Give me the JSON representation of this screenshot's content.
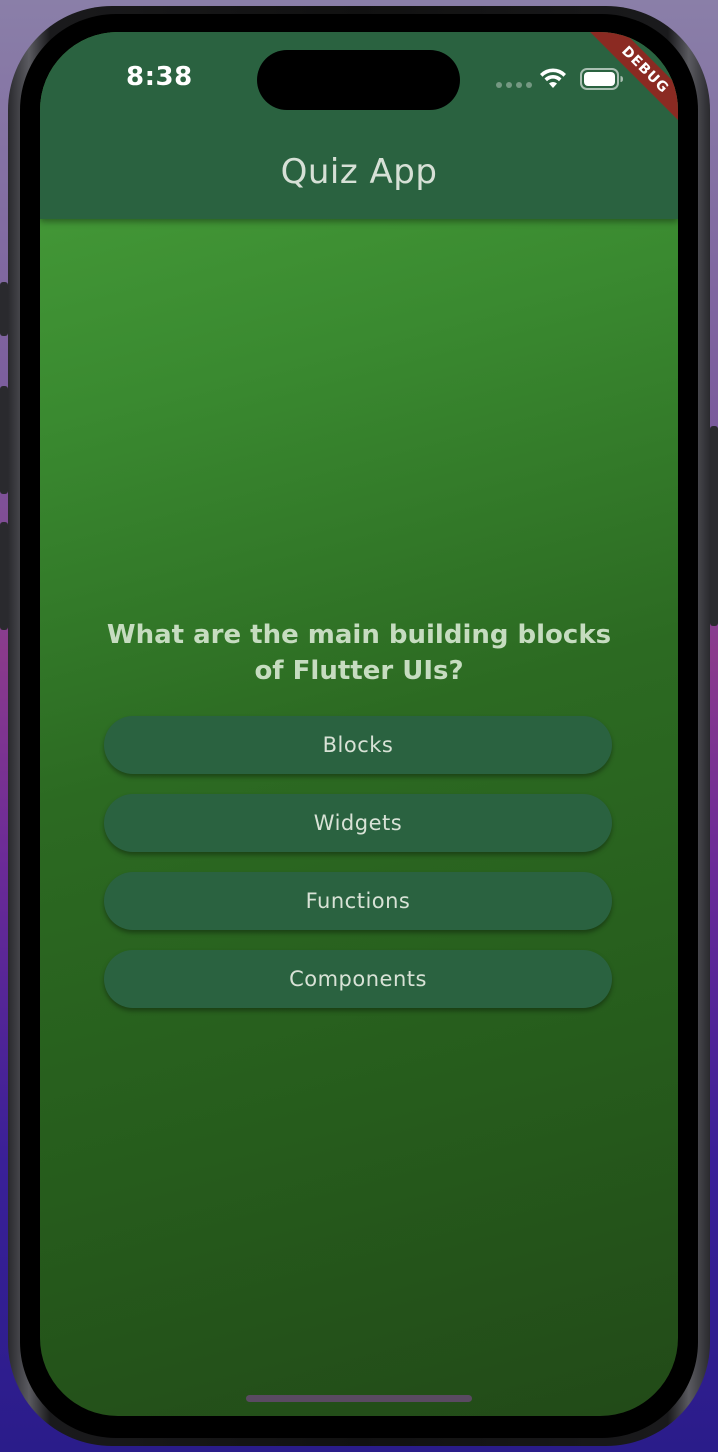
{
  "status_bar": {
    "time": "8:38"
  },
  "debug_banner": {
    "label": "DEBUG"
  },
  "appbar": {
    "title": "Quiz App"
  },
  "quiz": {
    "question": "What are the main building blocks of Flutter UIs?",
    "answers": [
      "Blocks",
      "Widgets",
      "Functions",
      "Components"
    ]
  },
  "colors": {
    "appbar": "#2a6240",
    "background_top": "#4aa23c",
    "background_bottom": "#224a18",
    "answer_button": "#2a6240",
    "debug_banner": "#8b2a22"
  },
  "icons": {
    "signal": "cellular-signal-icon",
    "wifi": "wifi-icon",
    "battery": "battery-icon"
  }
}
